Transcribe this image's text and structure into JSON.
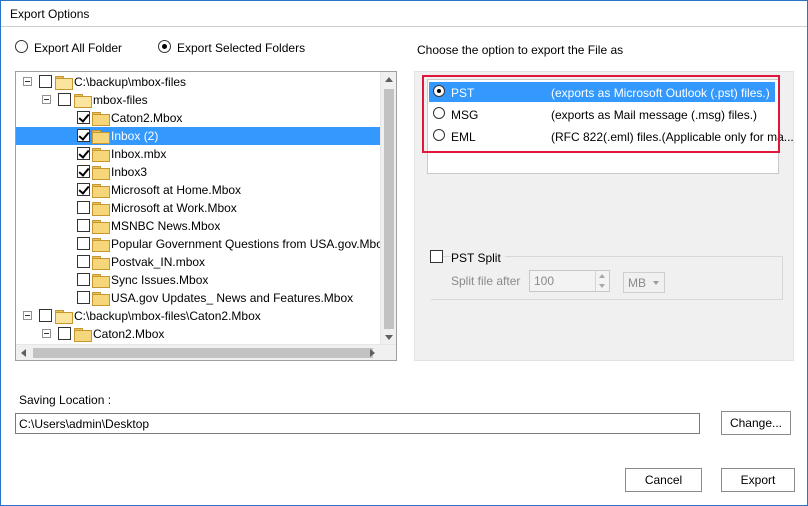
{
  "window": {
    "title": "Export Options"
  },
  "scope": {
    "export_all_label": "Export All Folder",
    "export_selected_label": "Export Selected Folders",
    "selected": "selected"
  },
  "tree": {
    "rows": [
      {
        "label": "C:\\backup\\mbox-files",
        "checked": false,
        "selected": false
      },
      {
        "label": "mbox-files",
        "checked": false,
        "selected": false
      },
      {
        "label": "Caton2.Mbox",
        "checked": true,
        "selected": false
      },
      {
        "label": "Inbox (2)",
        "checked": true,
        "selected": true
      },
      {
        "label": "Inbox.mbx",
        "checked": true,
        "selected": false
      },
      {
        "label": "Inbox3",
        "checked": true,
        "selected": false
      },
      {
        "label": "Microsoft at Home.Mbox",
        "checked": true,
        "selected": false
      },
      {
        "label": "Microsoft at Work.Mbox",
        "checked": false,
        "selected": false
      },
      {
        "label": "MSNBC News.Mbox",
        "checked": false,
        "selected": false
      },
      {
        "label": "Popular Government Questions from USA.gov.Mbo",
        "checked": false,
        "selected": false
      },
      {
        "label": "Postvak_IN.mbox",
        "checked": false,
        "selected": false
      },
      {
        "label": "Sync Issues.Mbox",
        "checked": false,
        "selected": false
      },
      {
        "label": "USA.gov Updates_ News and Features.Mbox",
        "checked": false,
        "selected": false
      },
      {
        "label": "C:\\backup\\mbox-files\\Caton2.Mbox",
        "checked": false,
        "selected": false
      },
      {
        "label": "Caton2.Mbox",
        "checked": false,
        "selected": false
      }
    ]
  },
  "export_format": {
    "heading": "Choose the option to export the File as",
    "options": [
      {
        "name": "PST",
        "desc": "(exports as Microsoft Outlook (.pst) files.)",
        "selected": true
      },
      {
        "name": "MSG",
        "desc": "(exports as Mail message (.msg) files.)",
        "selected": false
      },
      {
        "name": "EML",
        "desc": "(RFC 822(.eml) files.(Applicable only for ma...",
        "selected": false
      }
    ]
  },
  "pst_split": {
    "label": "PST Split",
    "split_after_label": "Split file after",
    "value": "100",
    "unit": "MB"
  },
  "saving": {
    "label": "Saving Location :",
    "path": "C:\\Users\\admin\\Desktop",
    "change_label": "Change..."
  },
  "buttons": {
    "cancel": "Cancel",
    "export": "Export"
  },
  "colors": {
    "selection": "#3399ff",
    "highlight": "#e0163a",
    "window_border": "#2b73c7"
  }
}
